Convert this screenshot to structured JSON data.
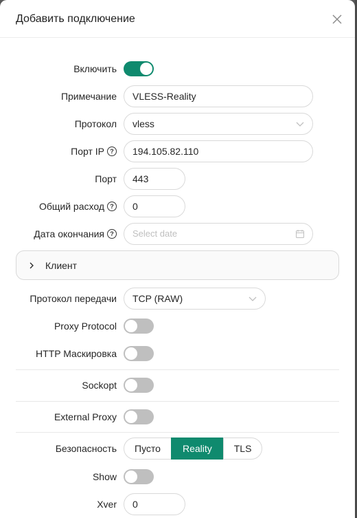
{
  "dialog": {
    "title": "Добавить подключение",
    "close_icon": "close-icon"
  },
  "form": {
    "enable": {
      "label": "Включить",
      "value": true
    },
    "remark": {
      "label": "Примечание",
      "value": "VLESS-Reality"
    },
    "protocol": {
      "label": "Протокол",
      "value": "vless"
    },
    "listen_ip": {
      "label": "Порт IP",
      "value": "194.105.82.110"
    },
    "port": {
      "label": "Порт",
      "value": "443"
    },
    "total_usage": {
      "label": "Общий расход",
      "value": "0"
    },
    "expiry": {
      "label": "Дата окончания",
      "placeholder": "Select date"
    },
    "client": {
      "label": "Клиент"
    },
    "transport": {
      "label": "Протокол передачи",
      "value": "TCP (RAW)"
    },
    "proxy_protocol": {
      "label": "Proxy Protocol",
      "value": false
    },
    "http_mask": {
      "label": "HTTP Маскировка",
      "value": false
    },
    "sockopt": {
      "label": "Sockopt",
      "value": false
    },
    "external_proxy": {
      "label": "External Proxy",
      "value": false
    },
    "security": {
      "label": "Безопасность",
      "options": [
        "Пусто",
        "Reality",
        "TLS"
      ],
      "selected": "Reality"
    },
    "show": {
      "label": "Show",
      "value": false
    },
    "xver": {
      "label": "Xver",
      "value": "0"
    }
  },
  "colors": {
    "accent": "#0f8a6e",
    "toggle_off": "#bfbfbf",
    "border": "#d9d9d9"
  }
}
